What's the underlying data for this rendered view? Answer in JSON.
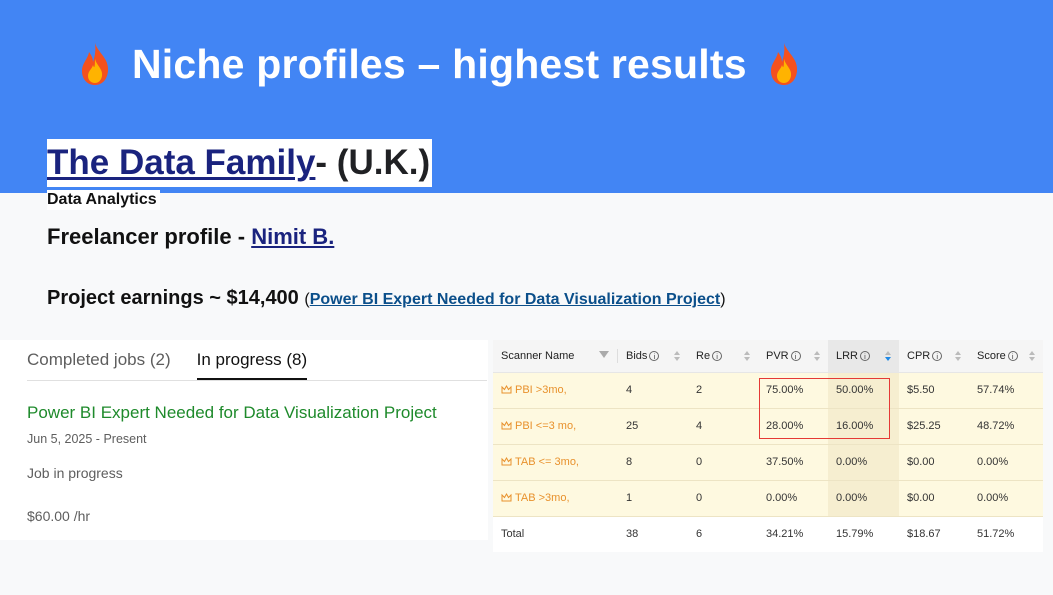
{
  "slide": {
    "headline": "Niche profiles – highest results",
    "headline_icon": "fire-icon",
    "agency_name": "The Data Family",
    "agency_region": " - (U.K.)",
    "agency_tag": "Data Analytics",
    "freelancer_label": "Freelancer profile - ",
    "freelancer_name": "Nimit B.",
    "earnings_label": "Project earnings ~ $14,400 ",
    "earnings_paren_open": "(",
    "earnings_project": "Power BI Expert Needed for Data Visualization Project",
    "earnings_paren_close": ")"
  },
  "jobs_panel": {
    "tabs": [
      {
        "label": "Completed jobs (2)",
        "active": false
      },
      {
        "label": "In progress (8)",
        "active": true
      }
    ],
    "job": {
      "title": "Power BI Expert Needed for Data Visualization Project",
      "date": "Jun 5, 2025 - Present",
      "status": "Job in progress",
      "rate": "$60.00 /hr"
    }
  },
  "scanner_table": {
    "headers": [
      "Scanner Name",
      "Bids",
      "Re",
      "PVR",
      "LRR",
      "CPR",
      "Score"
    ],
    "rows": [
      {
        "name": "PBI >3mo,",
        "bids": "4",
        "re": "2",
        "pvr": "75.00%",
        "lrr": "50.00%",
        "cpr": "$5.50",
        "score": "57.74%"
      },
      {
        "name": "PBI <=3 mo,",
        "bids": "25",
        "re": "4",
        "pvr": "28.00%",
        "lrr": "16.00%",
        "cpr": "$25.25",
        "score": "48.72%"
      },
      {
        "name": "TAB <= 3mo,",
        "bids": "8",
        "re": "0",
        "pvr": "37.50%",
        "lrr": "0.00%",
        "cpr": "$0.00",
        "score": "0.00%"
      },
      {
        "name": "TAB >3mo,",
        "bids": "1",
        "re": "0",
        "pvr": "0.00%",
        "lrr": "0.00%",
        "cpr": "$0.00",
        "score": "0.00%"
      }
    ],
    "total": {
      "name": "Total",
      "bids": "38",
      "re": "6",
      "pvr": "34.21%",
      "lrr": "15.79%",
      "cpr": "$18.67",
      "score": "51.72%"
    }
  },
  "colors": {
    "banner": "#4285f4",
    "job_title": "#1e8a2b",
    "scanner_name": "#e8912c",
    "highlight_box": "#e53935"
  }
}
